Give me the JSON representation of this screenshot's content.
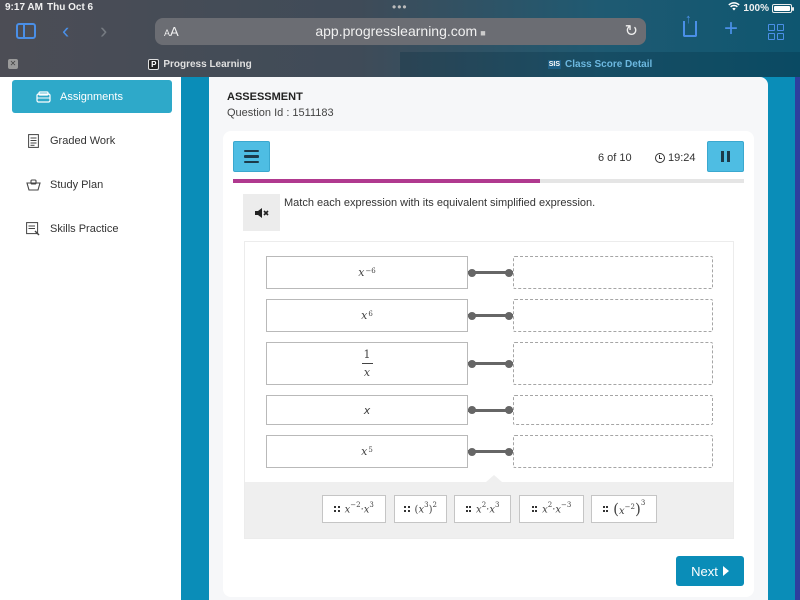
{
  "status_bar": {
    "time": "9:17 AM",
    "date": "Thu Oct 6",
    "battery": "100%"
  },
  "browser": {
    "text_size_label_small": "A",
    "text_size_label_large": "A",
    "url": "app.progresslearning.com",
    "tabs": [
      {
        "label": "Progress Learning",
        "favicon": "P",
        "active": true
      },
      {
        "label": "Class Score Detail",
        "favicon": "SIS",
        "active": false
      }
    ],
    "icons": {
      "back": "‹",
      "forward": "›",
      "reload": "↻",
      "plus": "+",
      "lock": "🔒"
    }
  },
  "sidebar": {
    "items": [
      {
        "label": "Assignments",
        "icon": "assignments-icon",
        "active": true
      },
      {
        "label": "Graded Work",
        "icon": "graded-work-icon",
        "active": false
      },
      {
        "label": "Study Plan",
        "icon": "study-plan-icon",
        "active": false
      },
      {
        "label": "Skills Practice",
        "icon": "skills-practice-icon",
        "active": false
      }
    ]
  },
  "assessment": {
    "heading": "ASSESSMENT",
    "question_id": "Question Id : 1511183",
    "counter": "6 of 10",
    "timer": "19:24",
    "progress_fraction": 0.6,
    "prompt": "Match each expression with its equivalent simplified expression.",
    "mute_icon": "🔇",
    "left_items": [
      {
        "base": "x",
        "exp": "−6"
      },
      {
        "base": "x",
        "exp": "6"
      },
      {
        "numerator": "1",
        "denominator": "x"
      },
      {
        "base": "x",
        "exp": ""
      },
      {
        "base": "x",
        "exp": "5"
      }
    ],
    "answer_chips": [
      {
        "parts": [
          {
            "base": "x",
            "exp": "−2"
          },
          {
            "sep": "·"
          },
          {
            "base": "x",
            "exp": "3"
          }
        ]
      },
      {
        "text_open": "(",
        "inner_base": "x",
        "inner_exp": "3",
        "text_close": ")",
        "outer_exp": "2"
      },
      {
        "parts": [
          {
            "base": "x",
            "exp": "2"
          },
          {
            "sep": "·"
          },
          {
            "base": "x",
            "exp": "3"
          }
        ]
      },
      {
        "parts": [
          {
            "base": "x",
            "exp": "2"
          },
          {
            "sep": "·"
          },
          {
            "base": "x",
            "exp": "−3"
          }
        ]
      },
      {
        "text_open": "(",
        "inner_base": "x",
        "inner_exp": "−2",
        "text_close": ")",
        "outer_exp": "3"
      }
    ],
    "next_label": "Next"
  },
  "colors": {
    "accent_blue": "#0a8db8",
    "button_blue": "#4ebde3",
    "progress": "#b0398f",
    "active_nav": "#2ea9c9"
  }
}
